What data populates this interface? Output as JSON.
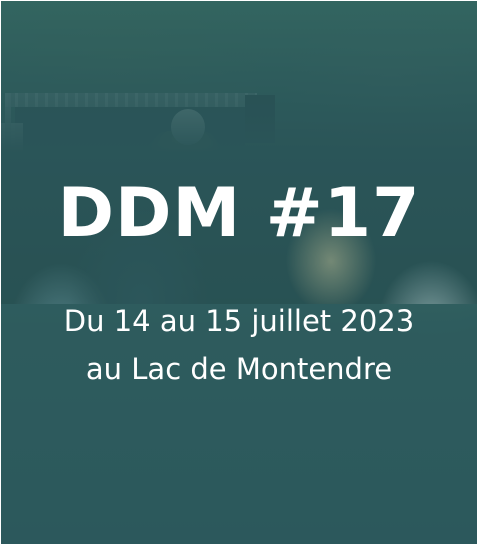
{
  "event": {
    "title": "DDM #17",
    "dates": "Du 14 au 15 juillet 2023",
    "location": "au Lac de Montendre"
  },
  "colors": {
    "overlay": "#2e6064",
    "text": "#ffffff"
  }
}
